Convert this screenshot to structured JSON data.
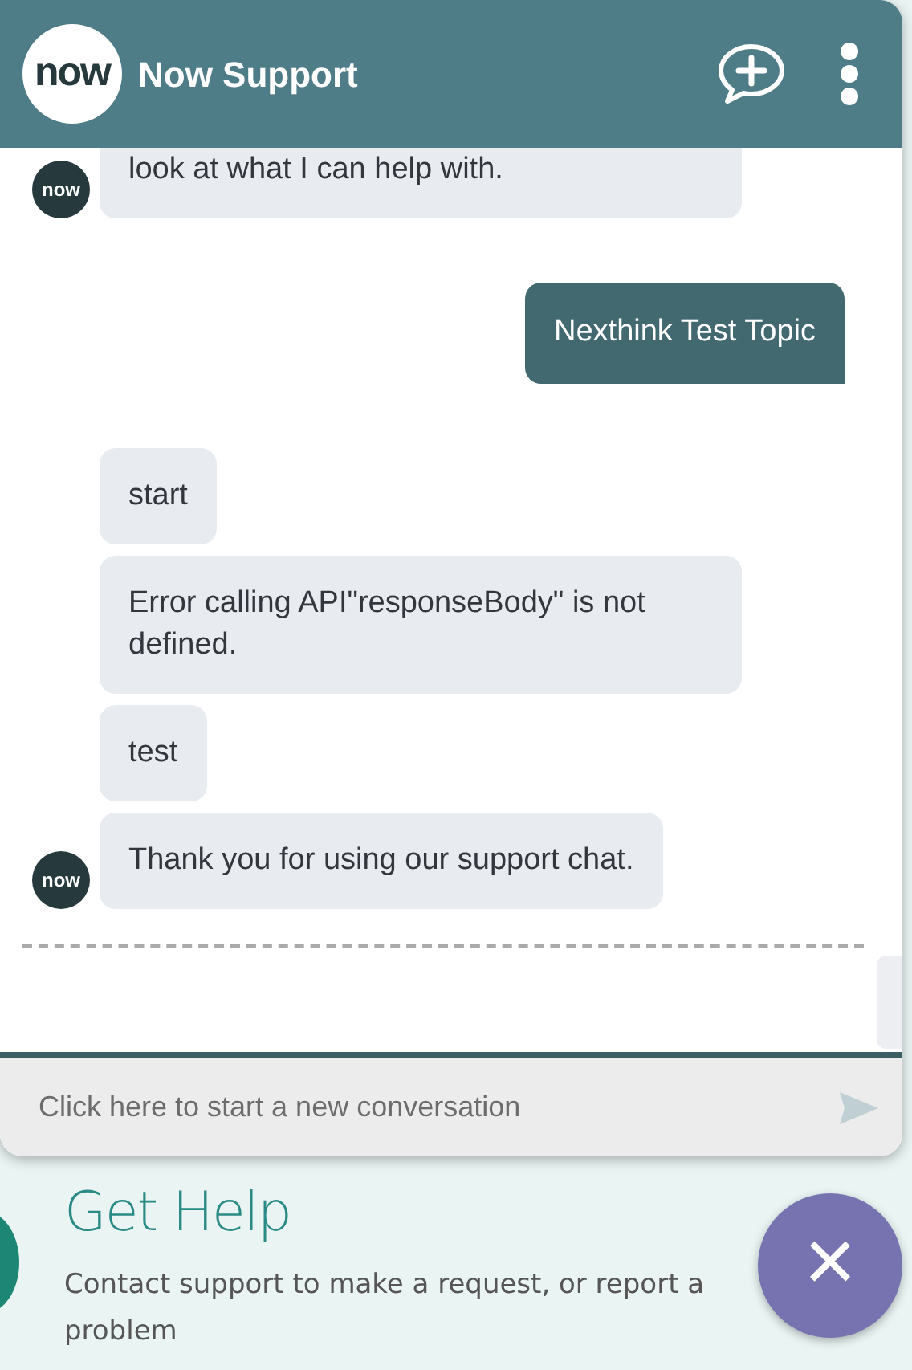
{
  "header": {
    "logo": "now",
    "title": "Now Support"
  },
  "messages": [
    {
      "kind": "bot",
      "text": "look at what I can help with.",
      "avatar": "now"
    },
    {
      "kind": "user",
      "text": "Nexthink Test Topic"
    },
    {
      "kind": "bot",
      "text": "start"
    },
    {
      "kind": "bot",
      "text": "Error calling API\"responseBody\" is not defined."
    },
    {
      "kind": "bot",
      "text": "test"
    },
    {
      "kind": "bot",
      "text": "Thank you for using our support chat.",
      "avatar": "now"
    }
  ],
  "composer": {
    "placeholder": "Click here to start a new conversation"
  },
  "page": {
    "title": "Get Help",
    "description": "Contact support to make a request, or report a problem"
  },
  "close_button": "×"
}
